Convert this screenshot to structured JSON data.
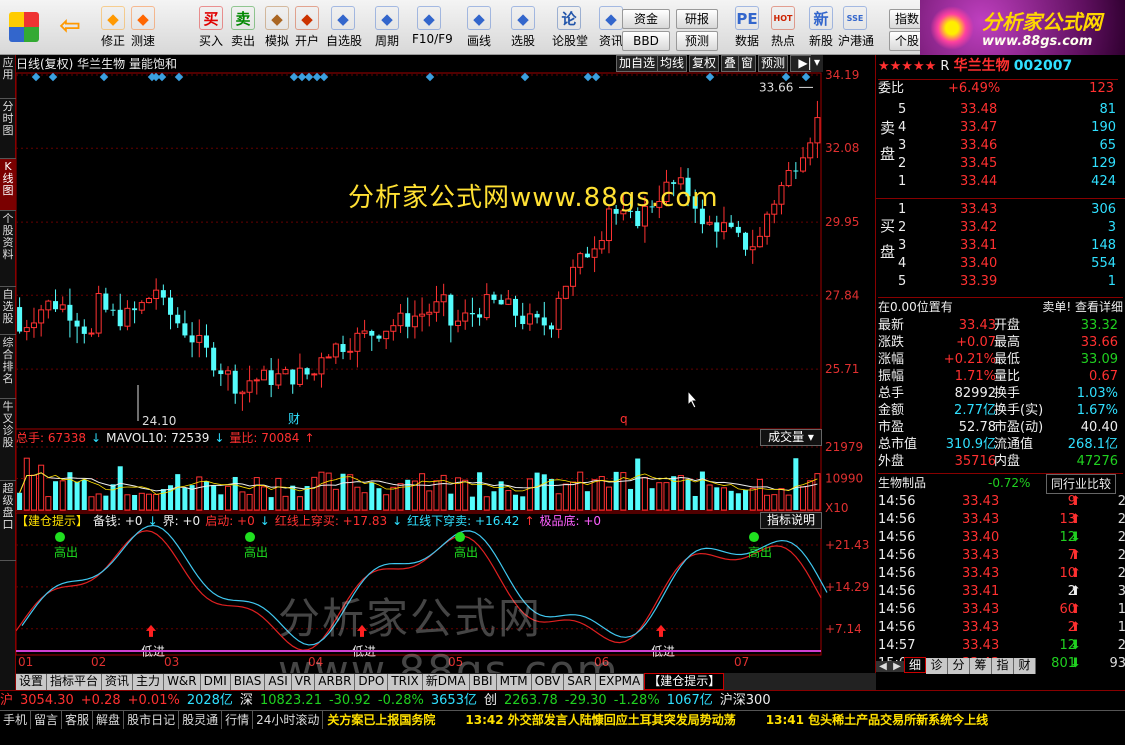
{
  "toolbar": {
    "buttons": [
      {
        "label": "修正",
        "icon": "up-down-arrows-icon",
        "color": "#ff9900"
      },
      {
        "label": "测速",
        "icon": "speed-clock-icon",
        "color": "#ff6600"
      },
      {
        "label": "买入",
        "icon": "buy-icon",
        "glyph": "买",
        "color": "#e00000"
      },
      {
        "label": "卖出",
        "icon": "sell-icon",
        "glyph": "卖",
        "color": "#008800"
      },
      {
        "label": "模拟",
        "icon": "gavel-icon",
        "color": "#aa6622"
      },
      {
        "label": "开户",
        "icon": "open-account-icon",
        "color": "#cc3300"
      },
      {
        "label": "自选股",
        "icon": "favorites-icon",
        "color": "#3366cc"
      },
      {
        "label": "周期",
        "icon": "cycle-icon",
        "color": "#3366cc"
      },
      {
        "label": "F10/F9",
        "icon": "f10-icon",
        "color": "#3366cc"
      },
      {
        "label": "画线",
        "icon": "pen-icon",
        "color": "#3366cc"
      },
      {
        "label": "选股",
        "icon": "stock-screen-icon",
        "color": "#3366cc"
      },
      {
        "label": "论股堂",
        "icon": "forum-icon",
        "glyph": "论",
        "color": "#2255aa"
      },
      {
        "label": "资讯",
        "icon": "news-icon",
        "color": "#3366cc"
      },
      {
        "label": "数据",
        "icon": "pe-data-icon",
        "glyph": "PE",
        "color": "#3366cc"
      },
      {
        "label": "热点",
        "icon": "hot-icon",
        "glyph": "HOT",
        "color": "#cc2200"
      },
      {
        "label": "新股",
        "icon": "new-stock-icon",
        "glyph": "新",
        "color": "#3366cc"
      },
      {
        "label": "沪港通",
        "icon": "sse-hk-icon",
        "glyph": "SSE",
        "color": "#3366cc"
      }
    ],
    "small": [
      "资金",
      "研报",
      "BBD",
      "预测",
      "指数",
      "个股"
    ]
  },
  "brand": {
    "name": "分析家公式网",
    "url": "www.88gs.com"
  },
  "leftbar": [
    "应用",
    "分时图",
    "K线图",
    "个股资料",
    "自选股",
    "综合排名",
    "牛叉诊股",
    "超级盘口"
  ],
  "chart": {
    "title": "日线(复权)  华兰生物  量能饱和",
    "buttons": [
      "加自选",
      "均线",
      "复权",
      "叠",
      "窗",
      "预测"
    ],
    "watermark1": "分析家公式网www.88gs.com",
    "watermark2": "分析家公式网www.88gs.com",
    "price_axis": [
      "34.19",
      "32.08",
      "29.95",
      "27.84",
      "25.71"
    ],
    "high_label": "33.66",
    "low_label": "24.10",
    "markers": [
      "财",
      "q"
    ],
    "vol_axis": [
      "21979",
      "10990",
      "X10"
    ],
    "ind_axis": [
      "+21.43",
      "+14.29",
      "+7.14"
    ],
    "months": [
      "01",
      "02",
      "03",
      "04",
      "05",
      "06",
      "07"
    ],
    "vol_mode": "成交量",
    "ind_button": "指标说明",
    "signal_high": "高出",
    "signal_low": "低进"
  },
  "indicator_vol": [
    {
      "t": "总手: 67338",
      "c": "#ff3030"
    },
    {
      "t": "↓",
      "c": "#30e0ff"
    },
    {
      "t": "MAVOL10: 72539",
      "c": "#eeeeee"
    },
    {
      "t": "↓",
      "c": "#30e0ff"
    },
    {
      "t": "量比: 70084",
      "c": "#ff3030"
    },
    {
      "t": "↑",
      "c": "#ff3030"
    }
  ],
  "indicator_jc": [
    {
      "t": "【建仓提示】",
      "c": "#ffe000"
    },
    {
      "t": "备钱: +0",
      "c": "#eeeeee"
    },
    {
      "t": "↓",
      "c": "#30e0ff"
    },
    {
      "t": "界: +0",
      "c": "#eeeeee"
    },
    {
      "t": "启动: +0",
      "c": "#ff3030"
    },
    {
      "t": "↓",
      "c": "#30e0ff"
    },
    {
      "t": "红线上穿买: +17.83",
      "c": "#ff3030"
    },
    {
      "t": "↓",
      "c": "#30e0ff"
    },
    {
      "t": "红线下穿卖: +16.42",
      "c": "#30e0ff"
    },
    {
      "t": "↑",
      "c": "#ff3030"
    },
    {
      "t": "极品底: +0",
      "c": "#ff60ff"
    }
  ],
  "chart_data": [
    {
      "type": "candlestick",
      "ylim": [
        24.1,
        34.19
      ],
      "high": 33.66,
      "low": 24.1
    },
    {
      "type": "bar",
      "name": "成交量",
      "ylim": [
        0,
        21979
      ]
    },
    {
      "type": "line",
      "name": "建仓提示",
      "ylim": [
        3,
        24
      ],
      "ticks": [
        21.43,
        14.29,
        7.14
      ]
    }
  ],
  "bottom_tabs": [
    "设置",
    "指标平台",
    "资讯",
    "主力",
    "W&R",
    "DMI",
    "BIAS",
    "ASI",
    "VR",
    "ARBR",
    "DPO",
    "TRIX",
    "新DMA",
    "BBI",
    "MTM",
    "OBV",
    "SAR",
    "EXPMA",
    "【建仓提示】"
  ],
  "quote": {
    "stars": "★★★★★",
    "flag": "R",
    "name": "华兰生物",
    "code": "002007",
    "weibi_label": "委比",
    "weibi": "+6.49%",
    "weibi_vol": "123",
    "sell_label": "卖盘",
    "buy_label": "买盘",
    "sell": [
      [
        "5",
        "33.48",
        "81"
      ],
      [
        "4",
        "33.47",
        "190"
      ],
      [
        "3",
        "33.46",
        "65"
      ],
      [
        "2",
        "33.45",
        "129"
      ],
      [
        "1",
        "33.44",
        "424"
      ]
    ],
    "buy": [
      [
        "1",
        "33.43",
        "306"
      ],
      [
        "2",
        "33.42",
        "3"
      ],
      [
        "3",
        "33.41",
        "148"
      ],
      [
        "4",
        "33.40",
        "554"
      ],
      [
        "5",
        "33.39",
        "1"
      ]
    ],
    "pos_text": "在0.00位置有",
    "pos_right": "卖单! 查看详细",
    "stats": [
      [
        "最新",
        "33.43",
        "开盘",
        "33.32"
      ],
      [
        "涨跌",
        "+0.07",
        "最高",
        "33.66"
      ],
      [
        "涨幅",
        "+0.21%",
        "最低",
        "33.09"
      ],
      [
        "振幅",
        "1.71%",
        "量比",
        "0.67"
      ],
      [
        "总手",
        "82992",
        "换手",
        "1.03%"
      ],
      [
        "金额",
        "2.77亿",
        "换手(实)",
        "1.67%"
      ],
      [
        "市盈",
        "52.78",
        "市盈(动)",
        "40.40"
      ],
      [
        "总市值",
        "310.9亿",
        "流通值",
        "268.1亿"
      ],
      [
        "外盘",
        "35716",
        "内盘",
        "47276"
      ]
    ],
    "sector": "生物制品",
    "sector_chg": "-0.72%",
    "sector_btn": "同行业比较",
    "ticks": [
      [
        "14:56",
        "33.43",
        "9",
        "up"
      ],
      [
        "14:56",
        "33.43",
        "13",
        "up"
      ],
      [
        "14:56",
        "33.40",
        "12",
        "down"
      ],
      [
        "14:56",
        "33.43",
        "7",
        "up"
      ],
      [
        "14:56",
        "33.43",
        "10",
        "up"
      ],
      [
        "14:56",
        "33.41",
        "2",
        "up-white"
      ],
      [
        "14:56",
        "33.43",
        "60",
        "up"
      ],
      [
        "14:56",
        "33.43",
        "2",
        "up"
      ],
      [
        "14:57",
        "33.43",
        "12",
        "down"
      ],
      [
        "15:00",
        "33.43",
        "801",
        "down"
      ]
    ],
    "tick_tail": [
      "2",
      "2",
      "2",
      "2",
      "2",
      "3",
      "1",
      "1",
      "2",
      "93"
    ],
    "right_tabs": [
      "细",
      "诊",
      "分",
      "筹",
      "指",
      "财"
    ]
  },
  "status": [
    {
      "t": "沪",
      "c": "#ff3030"
    },
    {
      "t": "3054.30",
      "c": "#ff3030"
    },
    {
      "t": "+0.28",
      "c": "#ff3030"
    },
    {
      "t": "+0.01%",
      "c": "#ff3030"
    },
    {
      "t": "2028亿",
      "c": "#30e0ff"
    },
    {
      "t": "深",
      "c": "#eeeeee"
    },
    {
      "t": "10823.21",
      "c": "#20d020"
    },
    {
      "t": "-30.92",
      "c": "#20d020"
    },
    {
      "t": "-0.28%",
      "c": "#20d020"
    },
    {
      "t": "3653亿",
      "c": "#30e0ff"
    },
    {
      "t": "创",
      "c": "#eeeeee"
    },
    {
      "t": "2263.78",
      "c": "#20d020"
    },
    {
      "t": "-29.30",
      "c": "#20d020"
    },
    {
      "t": "-1.28%",
      "c": "#20d020"
    },
    {
      "t": "1067亿",
      "c": "#30e0ff"
    },
    {
      "t": "沪深300",
      "c": "#eeeeee"
    }
  ],
  "ticker_tabs": [
    "手机",
    "留言",
    "客服",
    "解盘",
    "股市日记",
    "股灵通",
    "行情",
    "24小时滚动"
  ],
  "ticker_news": [
    "关方案已上报国务院",
    "13:42 外交部发言人陆慷回应土耳其突发局势动荡",
    "13:41 包头稀土产品交易所新系统今上线"
  ]
}
